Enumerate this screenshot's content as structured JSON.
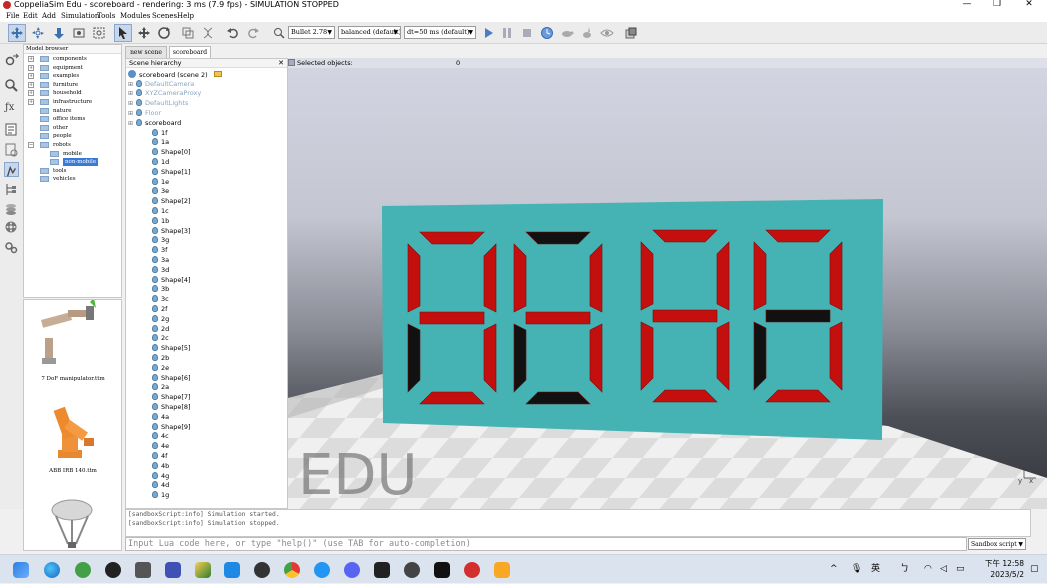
{
  "window": {
    "title": "CoppeliaSim Edu - scoreboard - rendering: 3 ms (7.9 fps) - SIMULATION STOPPED",
    "minimize": "—",
    "maximize": "❐",
    "close": "✕"
  },
  "menu": [
    "File",
    "Edit",
    "Add",
    "Simulation",
    "Tools",
    "Modules",
    "Scenes",
    "Help"
  ],
  "toolbar": {
    "engine": "Bullet 2.78",
    "accuracy": "balanced (default)",
    "timestep": "dt=50 ms (default)"
  },
  "model_browser": {
    "title": "Model browser",
    "items": [
      {
        "label": "components",
        "expandable": true
      },
      {
        "label": "equipment",
        "expandable": true
      },
      {
        "label": "examples",
        "expandable": true
      },
      {
        "label": "furniture",
        "expandable": true
      },
      {
        "label": "household",
        "expandable": true
      },
      {
        "label": "infrastructure",
        "expandable": true
      },
      {
        "label": "nature",
        "expandable": false
      },
      {
        "label": "office items",
        "expandable": false
      },
      {
        "label": "other",
        "expandable": false
      },
      {
        "label": "people",
        "expandable": false
      },
      {
        "label": "robots",
        "expandable": true,
        "expanded": true
      },
      {
        "label": "mobile",
        "expandable": false,
        "child": true
      },
      {
        "label": "non-mobile",
        "expandable": false,
        "child": true,
        "selected": true
      },
      {
        "label": "tools",
        "expandable": false
      },
      {
        "label": "vehicles",
        "expandable": false
      }
    ],
    "thumbnails": [
      "7 DoF manipulator.ttm",
      "ABB IRB 140.ttm"
    ]
  },
  "tabs": [
    "new scene",
    "scoreboard"
  ],
  "hierarchy": {
    "title": "Scene hierarchy",
    "close": "✕",
    "root": "scoreboard (scene 2)",
    "items": [
      {
        "label": "DefaultCamera",
        "level": 1,
        "grey": true
      },
      {
        "label": "XYZCameraProxy",
        "level": 1,
        "grey": true
      },
      {
        "label": "DefaultLights",
        "level": 1,
        "grey": true
      },
      {
        "label": "Floor",
        "level": 1,
        "grey": true
      },
      {
        "label": "scoreboard",
        "level": 1,
        "grey": false
      },
      {
        "label": "1f",
        "level": 2
      },
      {
        "label": "1a",
        "level": 2
      },
      {
        "label": "Shape[0]",
        "level": 2
      },
      {
        "label": "1d",
        "level": 2
      },
      {
        "label": "Shape[1]",
        "level": 2
      },
      {
        "label": "1e",
        "level": 2
      },
      {
        "label": "3e",
        "level": 2
      },
      {
        "label": "Shape[2]",
        "level": 2
      },
      {
        "label": "1c",
        "level": 2
      },
      {
        "label": "1b",
        "level": 2
      },
      {
        "label": "Shape[3]",
        "level": 2
      },
      {
        "label": "3g",
        "level": 2
      },
      {
        "label": "3f",
        "level": 2
      },
      {
        "label": "3a",
        "level": 2
      },
      {
        "label": "3d",
        "level": 2
      },
      {
        "label": "Shape[4]",
        "level": 2
      },
      {
        "label": "3b",
        "level": 2
      },
      {
        "label": "3c",
        "level": 2
      },
      {
        "label": "2f",
        "level": 2
      },
      {
        "label": "2g",
        "level": 2
      },
      {
        "label": "2d",
        "level": 2
      },
      {
        "label": "2c",
        "level": 2
      },
      {
        "label": "Shape[5]",
        "level": 2
      },
      {
        "label": "2b",
        "level": 2
      },
      {
        "label": "2e",
        "level": 2
      },
      {
        "label": "Shape[6]",
        "level": 2
      },
      {
        "label": "2a",
        "level": 2
      },
      {
        "label": "Shape[7]",
        "level": 2
      },
      {
        "label": "Shape[8]",
        "level": 2
      },
      {
        "label": "4a",
        "level": 2
      },
      {
        "label": "Shape[9]",
        "level": 2
      },
      {
        "label": "4c",
        "level": 2
      },
      {
        "label": "4e",
        "level": 2
      },
      {
        "label": "4f",
        "level": 2
      },
      {
        "label": "4b",
        "level": 2
      },
      {
        "label": "4g",
        "level": 2
      },
      {
        "label": "4d",
        "level": 2
      },
      {
        "label": "1g",
        "level": 2
      }
    ]
  },
  "viewport": {
    "selected_label": "Selected objects:",
    "selected_count": "0",
    "watermark": "EDU",
    "axis_z": "z",
    "axis_y": "y",
    "axis_x": "x",
    "panel_color": "#45b3b3",
    "segment_on_color": "#c40f0f",
    "segment_off_color": "#111111",
    "digits": [
      {
        "a": true,
        "b": true,
        "c": true,
        "d": true,
        "e": false,
        "f": true,
        "g": true
      },
      {
        "a": false,
        "b": true,
        "c": true,
        "d": false,
        "e": false,
        "f": true,
        "g": true
      },
      {
        "a": true,
        "b": true,
        "c": true,
        "d": true,
        "e": true,
        "f": true,
        "g": true
      },
      {
        "a": true,
        "b": true,
        "c": true,
        "d": true,
        "e": false,
        "f": true,
        "g": false
      }
    ]
  },
  "console": {
    "lines": [
      "[sandboxScript:info] Simulation started.",
      "[sandboxScript:info] Simulation stopped."
    ]
  },
  "lua_input": {
    "placeholder": "Input Lua code here, or type \"help()\" (use TAB for auto-completion)"
  },
  "script_selector": "Sandbox script",
  "taskbar": {
    "ime": "英",
    "tray_char": "ㄅ",
    "time": "下午 12:58",
    "date": "2023/5/2",
    "caret": "^"
  }
}
